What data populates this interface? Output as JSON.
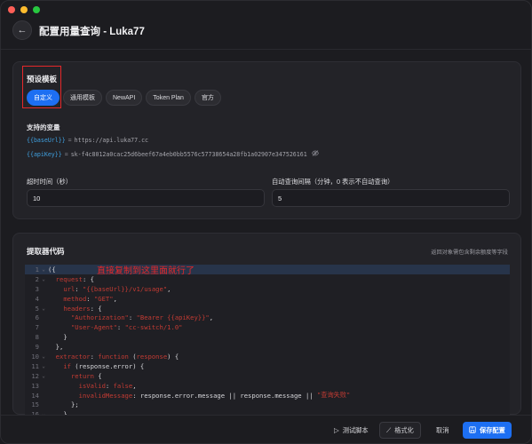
{
  "window": {
    "title": "配置用量查询 - Luka77"
  },
  "presets": {
    "title": "预设模板",
    "tabs": [
      "自定义",
      "通用模板",
      "NewAPI",
      "Token Plan",
      "官方"
    ],
    "active_index": 0
  },
  "variables": {
    "title": "支持的变量",
    "rows": [
      {
        "key": "{{baseUrl}}",
        "eq": "=",
        "value": "https://api.luka77.cc"
      },
      {
        "key": "{{apiKey}}",
        "eq": "=",
        "value": "sk-f4c8012a0cac25d6beef67a4eb0bb5576c57738654a28fb1a02907e347526161"
      }
    ]
  },
  "timeout": {
    "label": "超时时间（秒）",
    "value": "10"
  },
  "interval": {
    "label": "自动查询间隔（分钟，0 表示不自动查询）",
    "value": "5"
  },
  "extractor": {
    "title": "提取器代码",
    "hint": "返回对象需包含剩余额度等字段",
    "annotation": "直接复制到这里面就行了",
    "lines": [
      {
        "n": "1",
        "fold": "⌄",
        "parts": [
          [
            "p",
            "({"
          ]
        ]
      },
      {
        "n": "2",
        "fold": "⌄",
        "parts": [
          [
            "t",
            "  "
          ],
          [
            "k",
            "request"
          ],
          [
            "p",
            ": {"
          ]
        ]
      },
      {
        "n": "3",
        "fold": "",
        "parts": [
          [
            "t",
            "    "
          ],
          [
            "k",
            "url"
          ],
          [
            "p",
            ": "
          ],
          [
            "s",
            "\"{{baseUrl}}/v1/usage\""
          ],
          [
            "p",
            ","
          ]
        ]
      },
      {
        "n": "4",
        "fold": "",
        "parts": [
          [
            "t",
            "    "
          ],
          [
            "k",
            "method"
          ],
          [
            "p",
            ": "
          ],
          [
            "s",
            "\"GET\""
          ],
          [
            "p",
            ","
          ]
        ]
      },
      {
        "n": "5",
        "fold": "⌄",
        "parts": [
          [
            "t",
            "    "
          ],
          [
            "k",
            "headers"
          ],
          [
            "p",
            ": {"
          ]
        ]
      },
      {
        "n": "6",
        "fold": "",
        "parts": [
          [
            "t",
            "      "
          ],
          [
            "s",
            "\"Authorization\""
          ],
          [
            "p",
            ": "
          ],
          [
            "s",
            "\"Bearer {{apiKey}}\""
          ],
          [
            "p",
            ","
          ]
        ]
      },
      {
        "n": "7",
        "fold": "",
        "parts": [
          [
            "t",
            "      "
          ],
          [
            "s",
            "\"User-Agent\""
          ],
          [
            "p",
            ": "
          ],
          [
            "s",
            "\"cc-switch/1.0\""
          ]
        ]
      },
      {
        "n": "8",
        "fold": "",
        "parts": [
          [
            "t",
            "    "
          ],
          [
            "p",
            "}"
          ]
        ]
      },
      {
        "n": "9",
        "fold": "",
        "parts": [
          [
            "t",
            "  "
          ],
          [
            "p",
            "},"
          ]
        ]
      },
      {
        "n": "10",
        "fold": "⌄",
        "parts": [
          [
            "t",
            "  "
          ],
          [
            "k",
            "extractor"
          ],
          [
            "p",
            ": "
          ],
          [
            "k",
            "function"
          ],
          [
            "p",
            " ("
          ],
          [
            "k",
            "response"
          ],
          [
            "p",
            ") {"
          ]
        ]
      },
      {
        "n": "11",
        "fold": "⌄",
        "parts": [
          [
            "t",
            "    "
          ],
          [
            "k",
            "if"
          ],
          [
            "p",
            " (response.error) {"
          ]
        ]
      },
      {
        "n": "12",
        "fold": "⌄",
        "parts": [
          [
            "t",
            "      "
          ],
          [
            "k",
            "return"
          ],
          [
            "p",
            " {"
          ]
        ]
      },
      {
        "n": "13",
        "fold": "",
        "parts": [
          [
            "t",
            "        "
          ],
          [
            "k",
            "isValid"
          ],
          [
            "p",
            ": "
          ],
          [
            "k",
            "false"
          ],
          [
            "p",
            ","
          ]
        ]
      },
      {
        "n": "14",
        "fold": "",
        "parts": [
          [
            "t",
            "        "
          ],
          [
            "k",
            "invalidMessage"
          ],
          [
            "p",
            ": response.error.message || response.message || "
          ],
          [
            "s",
            "\"查询失败\""
          ]
        ]
      },
      {
        "n": "15",
        "fold": "",
        "parts": [
          [
            "t",
            "      "
          ],
          [
            "p",
            "};"
          ]
        ]
      },
      {
        "n": "16",
        "fold": "⌄",
        "parts": [
          [
            "t",
            "    "
          ],
          [
            "p",
            "}"
          ]
        ]
      }
    ]
  },
  "footer": {
    "test_label": "测试脚本",
    "format_label": "格式化",
    "cancel_label": "取消",
    "save_label": "保存配置"
  },
  "colors": {
    "accent": "#1d6ff2",
    "annotation": "#e5282a"
  }
}
